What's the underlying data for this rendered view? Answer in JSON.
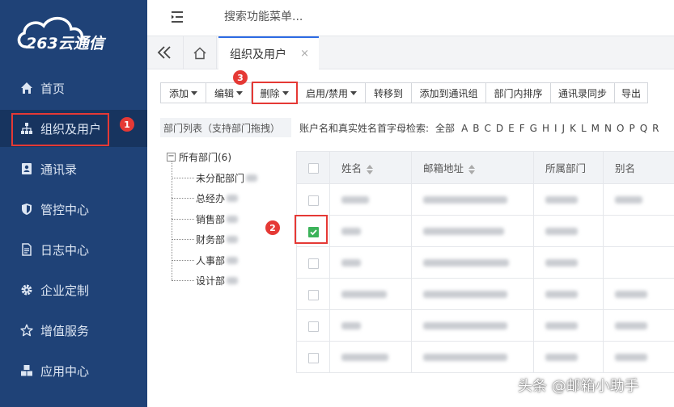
{
  "app": {
    "logo_text": "263云通信",
    "brand_color": "#1f4277",
    "accent_color": "#2d6be4",
    "annotation_color": "#e53935"
  },
  "sidebar": {
    "items": [
      {
        "label": "首页",
        "icon": "home-icon"
      },
      {
        "label": "组织及用户",
        "icon": "org-chart-icon",
        "active": true
      },
      {
        "label": "通讯录",
        "icon": "contact-book-icon"
      },
      {
        "label": "管控中心",
        "icon": "shield-icon"
      },
      {
        "label": "日志中心",
        "icon": "document-icon"
      },
      {
        "label": "企业定制",
        "icon": "gear-icon"
      },
      {
        "label": "增值服务",
        "icon": "star-icon"
      },
      {
        "label": "应用中心",
        "icon": "cubes-icon"
      }
    ]
  },
  "topbar": {
    "search_placeholder": "搜索功能菜单..."
  },
  "tabs": {
    "active_label": "组织及用户",
    "close_glyph": "×"
  },
  "toolbar": {
    "buttons": [
      {
        "label": "添加",
        "dropdown": true
      },
      {
        "label": "编辑",
        "dropdown": true
      },
      {
        "label": "删除",
        "dropdown": true
      },
      {
        "label": "启用/禁用",
        "dropdown": true
      },
      {
        "label": "转移到",
        "dropdown": false
      },
      {
        "label": "添加到通讯组",
        "dropdown": false
      },
      {
        "label": "部门内排序",
        "dropdown": false
      },
      {
        "label": "通讯录同步",
        "dropdown": false
      },
      {
        "label": "导出",
        "dropdown": false
      }
    ]
  },
  "annotations": [
    "1",
    "2",
    "3"
  ],
  "dept_tree": {
    "header": "部门列表（支持部门拖拽）",
    "root": {
      "toggle": "−",
      "label": "所有部门(6)"
    },
    "children": [
      "未分配部门",
      "总经办",
      "销售部",
      "财务部",
      "人事部",
      "设计部"
    ]
  },
  "alpha_filter": {
    "label": "账户名和真实姓名首字母检索:",
    "all": "全部",
    "letters": [
      "A",
      "B",
      "C",
      "D",
      "E",
      "F",
      "G",
      "H",
      "I",
      "J",
      "K",
      "L",
      "M",
      "N",
      "O",
      "P",
      "Q",
      "R"
    ]
  },
  "table": {
    "columns": [
      "姓名",
      "邮箱地址",
      "所属部门",
      "别名"
    ],
    "rows": [
      {
        "checked": false
      },
      {
        "checked": true
      },
      {
        "checked": false
      },
      {
        "checked": false
      },
      {
        "checked": false
      },
      {
        "checked": false
      }
    ]
  },
  "watermark": "头条 @邮箱小助手"
}
